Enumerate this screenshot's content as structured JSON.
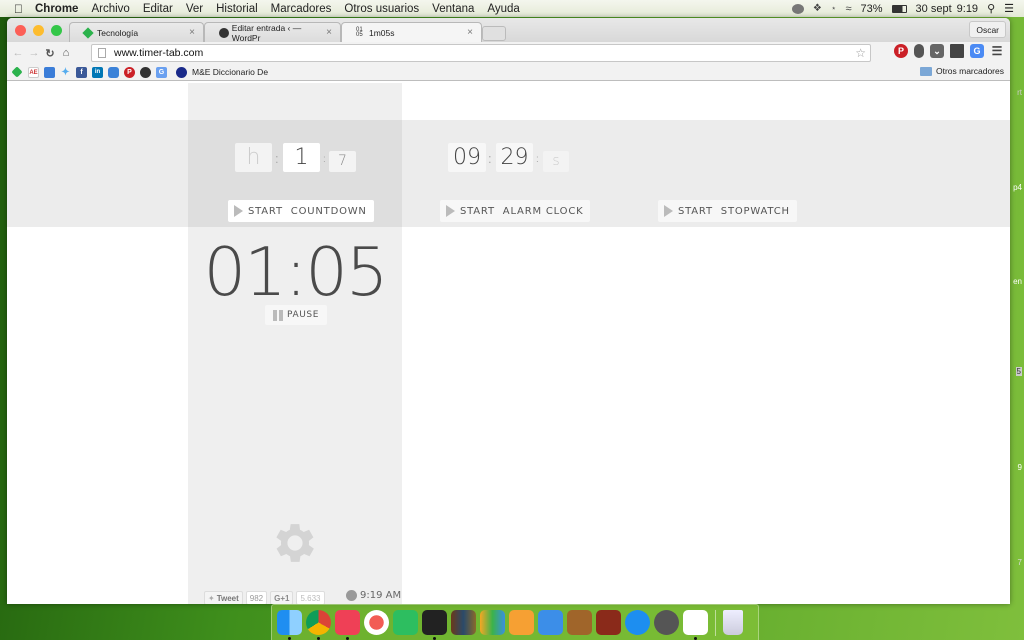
{
  "menubar": {
    "app_name": "Chrome",
    "items": [
      "Archivo",
      "Editar",
      "Ver",
      "Historial",
      "Marcadores",
      "Otros usuarios",
      "Ventana",
      "Ayuda"
    ],
    "battery": "73%",
    "date": "30 sept",
    "time": "9:19"
  },
  "browser": {
    "tabs": [
      {
        "title": "Tecnología",
        "active": false
      },
      {
        "title": "Editar entrada ‹ — WordPr",
        "active": false
      },
      {
        "title": "1m05s",
        "active": true
      }
    ],
    "close_glyph": "×",
    "user_button": "Oscar",
    "url": "www.timer-tab.com",
    "bookmarks": {
      "visible_label": "M&E Diccionario De",
      "other_bookmarks": "Otros marcadores"
    }
  },
  "timer_tab": {
    "countdown": {
      "hours_placeholder": "h",
      "minutes_value": "1",
      "seconds_value": "7",
      "start_label": "START  COUNTDOWN"
    },
    "alarm": {
      "hours_value": "09",
      "minutes_value": "29",
      "seconds_placeholder": "s",
      "start_label": "START  ALARM CLOCK"
    },
    "stopwatch": {
      "start_label": "START  STOPWATCH"
    },
    "running_time": "01:05",
    "pause_label": "PAUSE",
    "social": {
      "tweet_label": "Tweet",
      "tweet_count": "982",
      "gplus_label": "G+1",
      "gplus_count": "5.633"
    },
    "clock_time": "9:19 AM"
  },
  "desktop": {
    "edge_labels": [
      "rt",
      "p4",
      "en",
      "5",
      "9",
      "7"
    ]
  },
  "dock": {
    "apps": [
      "Finder",
      "Chrome",
      "Pocket",
      "Sunrise",
      "Evernote",
      "Scrivener",
      "iBooks",
      "Numbers",
      "Pages",
      "Keynote",
      "GarageBand",
      "Logic",
      "App Store",
      "System Preferences",
      "Simplenote",
      "Trash"
    ]
  }
}
